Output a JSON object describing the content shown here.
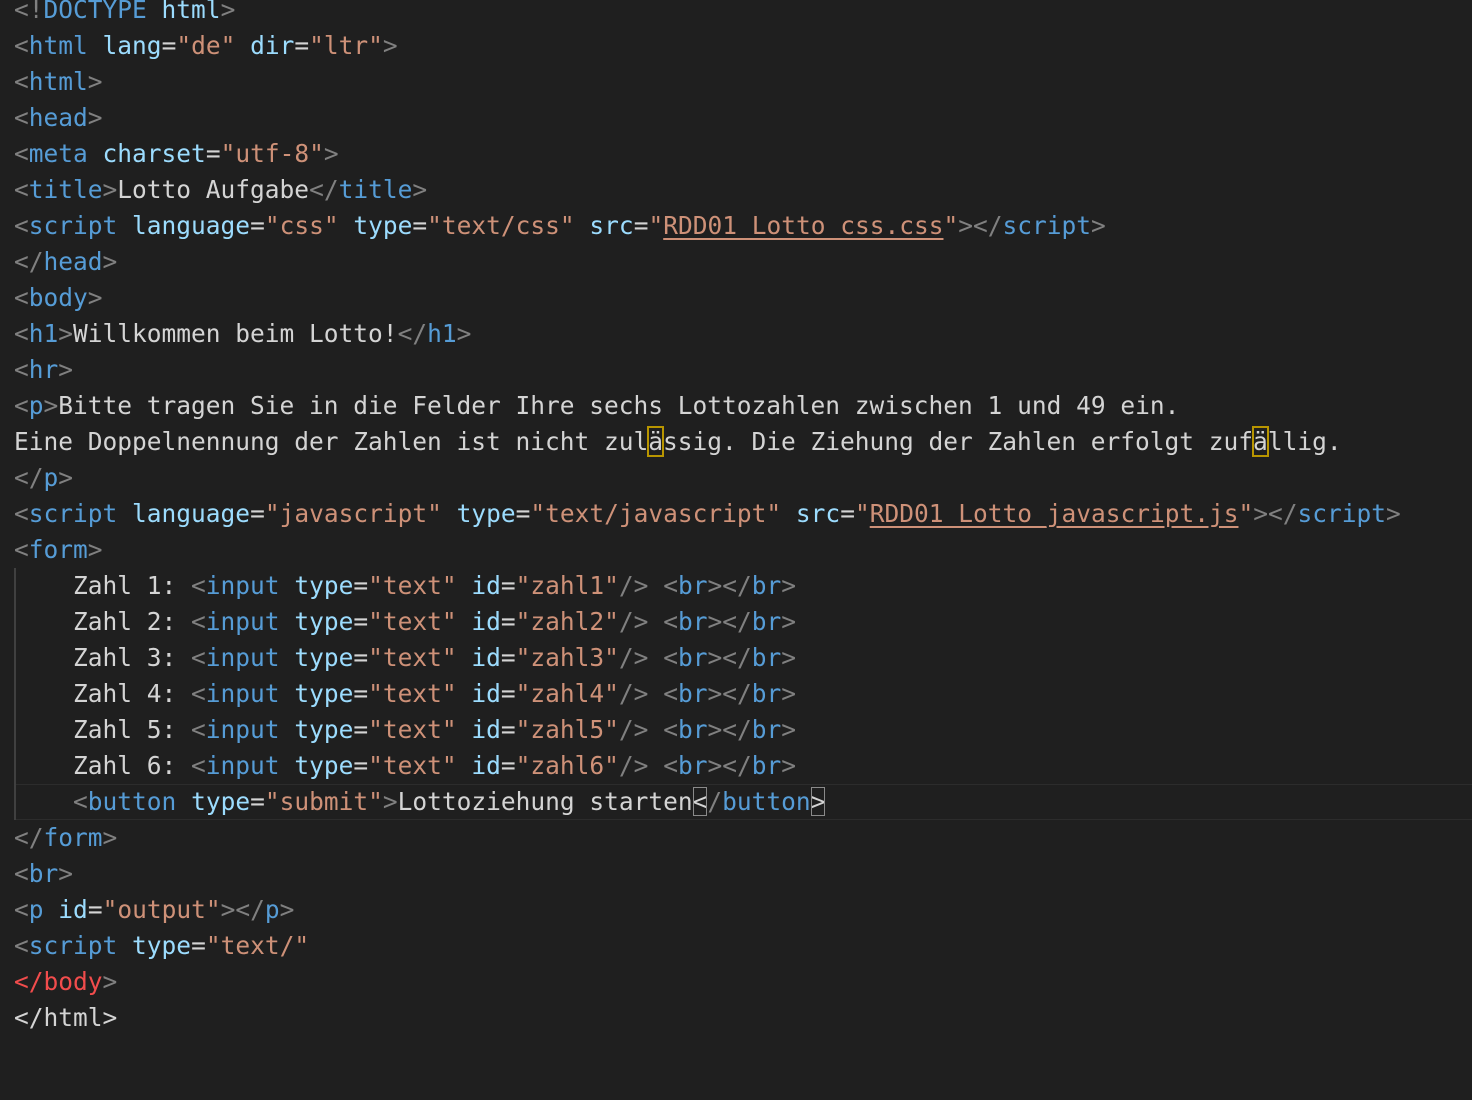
{
  "editor": {
    "language": "html",
    "colors": {
      "background": "#1f1f1f",
      "tag": "#569cd6",
      "attribute": "#9cdcfe",
      "string": "#ce9178",
      "text": "#d4d4d4",
      "punctuation": "#808080",
      "error": "#f14c4c"
    },
    "lines": [
      {
        "tokens": [
          [
            "t",
            "<!"
          ],
          [
            "tag",
            "DOCTYPE"
          ],
          [
            "txt",
            " "
          ],
          [
            "attr",
            "html"
          ],
          [
            "t",
            ">"
          ]
        ]
      },
      {
        "tokens": [
          [
            "t",
            "<"
          ],
          [
            "tag",
            "html"
          ],
          [
            "txt",
            " "
          ],
          [
            "attr",
            "lang"
          ],
          [
            "txt",
            "="
          ],
          [
            "str",
            "\"de\""
          ],
          [
            "txt",
            " "
          ],
          [
            "attr",
            "dir"
          ],
          [
            "txt",
            "="
          ],
          [
            "str",
            "\"ltr\""
          ],
          [
            "t",
            ">"
          ]
        ]
      },
      {
        "tokens": [
          [
            "t",
            "<"
          ],
          [
            "tag",
            "html"
          ],
          [
            "t",
            ">"
          ]
        ]
      },
      {
        "tokens": [
          [
            "t",
            "<"
          ],
          [
            "tag",
            "head"
          ],
          [
            "t",
            ">"
          ]
        ]
      },
      {
        "tokens": [
          [
            "t",
            "<"
          ],
          [
            "tag",
            "meta"
          ],
          [
            "txt",
            " "
          ],
          [
            "attr",
            "charset"
          ],
          [
            "txt",
            "="
          ],
          [
            "str",
            "\"utf-8\""
          ],
          [
            "t",
            ">"
          ]
        ]
      },
      {
        "tokens": [
          [
            "t",
            "<"
          ],
          [
            "tag",
            "title"
          ],
          [
            "t",
            ">"
          ],
          [
            "txt",
            "Lotto Aufgabe"
          ],
          [
            "t",
            "</"
          ],
          [
            "tag",
            "title"
          ],
          [
            "t",
            ">"
          ]
        ]
      },
      {
        "tokens": [
          [
            "t",
            "<"
          ],
          [
            "tag",
            "script"
          ],
          [
            "txt",
            " "
          ],
          [
            "attr",
            "language"
          ],
          [
            "txt",
            "="
          ],
          [
            "str",
            "\"css\""
          ],
          [
            "txt",
            " "
          ],
          [
            "attr",
            "type"
          ],
          [
            "txt",
            "="
          ],
          [
            "str",
            "\"text/css\""
          ],
          [
            "txt",
            " "
          ],
          [
            "attr",
            "src"
          ],
          [
            "txt",
            "="
          ],
          [
            "str",
            "\""
          ],
          [
            "link",
            "RDD01_Lotto_css.css"
          ],
          [
            "str",
            "\""
          ],
          [
            "t",
            "></"
          ],
          [
            "tag",
            "script"
          ],
          [
            "t",
            ">"
          ]
        ]
      },
      {
        "tokens": [
          [
            "t",
            "</"
          ],
          [
            "tag",
            "head"
          ],
          [
            "t",
            ">"
          ]
        ]
      },
      {
        "tokens": [
          [
            "t",
            "<"
          ],
          [
            "tag",
            "body"
          ],
          [
            "t",
            ">"
          ]
        ]
      },
      {
        "tokens": [
          [
            "t",
            "<"
          ],
          [
            "tag",
            "h1"
          ],
          [
            "t",
            ">"
          ],
          [
            "txt",
            "Willkommen beim Lotto!"
          ],
          [
            "t",
            "</"
          ],
          [
            "tag",
            "h1"
          ],
          [
            "t",
            ">"
          ]
        ]
      },
      {
        "tokens": [
          [
            "t",
            "<"
          ],
          [
            "tag",
            "hr"
          ],
          [
            "t",
            ">"
          ]
        ]
      },
      {
        "tokens": [
          [
            "t",
            "<"
          ],
          [
            "tag",
            "p"
          ],
          [
            "t",
            ">"
          ],
          [
            "txt",
            "Bitte tragen Sie in die Felder Ihre sechs Lottozahlen zwischen 1 und 49 ein."
          ]
        ]
      },
      {
        "tokens": [
          [
            "txt",
            "Eine Doppelnennung der Zahlen ist nicht zul"
          ],
          [
            "hl",
            "ä"
          ],
          [
            "txt",
            "ssig. Die Ziehung der Zahlen erfolgt zuf"
          ],
          [
            "hl",
            "ä"
          ],
          [
            "txt",
            "llig."
          ]
        ]
      },
      {
        "tokens": [
          [
            "t",
            "</"
          ],
          [
            "tag",
            "p"
          ],
          [
            "t",
            ">"
          ]
        ]
      },
      {
        "tokens": [
          [
            "t",
            "<"
          ],
          [
            "tag",
            "script"
          ],
          [
            "txt",
            " "
          ],
          [
            "attr",
            "language"
          ],
          [
            "txt",
            "="
          ],
          [
            "str",
            "\"javascript\""
          ],
          [
            "txt",
            " "
          ],
          [
            "attr",
            "type"
          ],
          [
            "txt",
            "="
          ],
          [
            "str",
            "\"text/javascript\""
          ],
          [
            "txt",
            " "
          ],
          [
            "attr",
            "src"
          ],
          [
            "txt",
            "="
          ],
          [
            "str",
            "\""
          ],
          [
            "link",
            "RDD01_Lotto_javascript.js"
          ],
          [
            "str",
            "\""
          ],
          [
            "t",
            "></"
          ],
          [
            "tag",
            "script"
          ],
          [
            "t",
            ">"
          ]
        ]
      },
      {
        "tokens": [
          [
            "t",
            "<"
          ],
          [
            "tag",
            "form"
          ],
          [
            "t",
            ">"
          ]
        ]
      },
      {
        "tokens": [
          [
            "txt",
            "    Zahl 1: "
          ],
          [
            "t",
            "<"
          ],
          [
            "tag",
            "input"
          ],
          [
            "txt",
            " "
          ],
          [
            "attr",
            "type"
          ],
          [
            "txt",
            "="
          ],
          [
            "str",
            "\"text\""
          ],
          [
            "txt",
            " "
          ],
          [
            "attr",
            "id"
          ],
          [
            "txt",
            "="
          ],
          [
            "str",
            "\"zahl1\""
          ],
          [
            "t",
            "/>"
          ],
          [
            "txt",
            " "
          ],
          [
            "t",
            "<"
          ],
          [
            "tag",
            "br"
          ],
          [
            "t",
            "></"
          ],
          [
            "tag",
            "br"
          ],
          [
            "t",
            ">"
          ]
        ]
      },
      {
        "tokens": [
          [
            "txt",
            "    Zahl 2: "
          ],
          [
            "t",
            "<"
          ],
          [
            "tag",
            "input"
          ],
          [
            "txt",
            " "
          ],
          [
            "attr",
            "type"
          ],
          [
            "txt",
            "="
          ],
          [
            "str",
            "\"text\""
          ],
          [
            "txt",
            " "
          ],
          [
            "attr",
            "id"
          ],
          [
            "txt",
            "="
          ],
          [
            "str",
            "\"zahl2\""
          ],
          [
            "t",
            "/>"
          ],
          [
            "txt",
            " "
          ],
          [
            "t",
            "<"
          ],
          [
            "tag",
            "br"
          ],
          [
            "t",
            "></"
          ],
          [
            "tag",
            "br"
          ],
          [
            "t",
            ">"
          ]
        ]
      },
      {
        "tokens": [
          [
            "txt",
            "    Zahl 3: "
          ],
          [
            "t",
            "<"
          ],
          [
            "tag",
            "input"
          ],
          [
            "txt",
            " "
          ],
          [
            "attr",
            "type"
          ],
          [
            "txt",
            "="
          ],
          [
            "str",
            "\"text\""
          ],
          [
            "txt",
            " "
          ],
          [
            "attr",
            "id"
          ],
          [
            "txt",
            "="
          ],
          [
            "str",
            "\"zahl3\""
          ],
          [
            "t",
            "/>"
          ],
          [
            "txt",
            " "
          ],
          [
            "t",
            "<"
          ],
          [
            "tag",
            "br"
          ],
          [
            "t",
            "></"
          ],
          [
            "tag",
            "br"
          ],
          [
            "t",
            ">"
          ]
        ]
      },
      {
        "tokens": [
          [
            "txt",
            "    Zahl 4: "
          ],
          [
            "t",
            "<"
          ],
          [
            "tag",
            "input"
          ],
          [
            "txt",
            " "
          ],
          [
            "attr",
            "type"
          ],
          [
            "txt",
            "="
          ],
          [
            "str",
            "\"text\""
          ],
          [
            "txt",
            " "
          ],
          [
            "attr",
            "id"
          ],
          [
            "txt",
            "="
          ],
          [
            "str",
            "\"zahl4\""
          ],
          [
            "t",
            "/>"
          ],
          [
            "txt",
            " "
          ],
          [
            "t",
            "<"
          ],
          [
            "tag",
            "br"
          ],
          [
            "t",
            "></"
          ],
          [
            "tag",
            "br"
          ],
          [
            "t",
            ">"
          ]
        ]
      },
      {
        "tokens": [
          [
            "txt",
            "    Zahl 5: "
          ],
          [
            "t",
            "<"
          ],
          [
            "tag",
            "input"
          ],
          [
            "txt",
            " "
          ],
          [
            "attr",
            "type"
          ],
          [
            "txt",
            "="
          ],
          [
            "str",
            "\"text\""
          ],
          [
            "txt",
            " "
          ],
          [
            "attr",
            "id"
          ],
          [
            "txt",
            "="
          ],
          [
            "str",
            "\"zahl5\""
          ],
          [
            "t",
            "/>"
          ],
          [
            "txt",
            " "
          ],
          [
            "t",
            "<"
          ],
          [
            "tag",
            "br"
          ],
          [
            "t",
            "></"
          ],
          [
            "tag",
            "br"
          ],
          [
            "t",
            ">"
          ]
        ]
      },
      {
        "tokens": [
          [
            "txt",
            "    Zahl 6: "
          ],
          [
            "t",
            "<"
          ],
          [
            "tag",
            "input"
          ],
          [
            "txt",
            " "
          ],
          [
            "attr",
            "type"
          ],
          [
            "txt",
            "="
          ],
          [
            "str",
            "\"text\""
          ],
          [
            "txt",
            " "
          ],
          [
            "attr",
            "id"
          ],
          [
            "txt",
            "="
          ],
          [
            "str",
            "\"zahl6\""
          ],
          [
            "t",
            "/>"
          ],
          [
            "txt",
            " "
          ],
          [
            "t",
            "<"
          ],
          [
            "tag",
            "br"
          ],
          [
            "t",
            "></"
          ],
          [
            "tag",
            "br"
          ],
          [
            "t",
            ">"
          ]
        ]
      },
      {
        "tokens": [
          [
            "txt",
            "    "
          ],
          [
            "t",
            "<"
          ],
          [
            "tag",
            "button"
          ],
          [
            "txt",
            " "
          ],
          [
            "attr",
            "type"
          ],
          [
            "txt",
            "="
          ],
          [
            "str",
            "\"submit\""
          ],
          [
            "t",
            ">"
          ],
          [
            "txt",
            "Lottoziehung starten"
          ],
          [
            "box",
            "<"
          ],
          [
            "t",
            "/"
          ],
          [
            "tag",
            "button"
          ],
          [
            "box",
            ">"
          ]
        ]
      },
      {
        "tokens": [
          [
            "t",
            "</"
          ],
          [
            "tag",
            "form"
          ],
          [
            "t",
            ">"
          ]
        ]
      },
      {
        "tokens": [
          [
            "t",
            "<"
          ],
          [
            "tag",
            "br"
          ],
          [
            "t",
            ">"
          ]
        ]
      },
      {
        "tokens": [
          [
            "t",
            "<"
          ],
          [
            "tag",
            "p"
          ],
          [
            "txt",
            " "
          ],
          [
            "attr",
            "id"
          ],
          [
            "txt",
            "="
          ],
          [
            "str",
            "\"output\""
          ],
          [
            "t",
            "></"
          ],
          [
            "tag",
            "p"
          ],
          [
            "t",
            ">"
          ]
        ]
      },
      {
        "tokens": [
          [
            "t",
            "<"
          ],
          [
            "tag",
            "script"
          ],
          [
            "txt",
            " "
          ],
          [
            "attr",
            "type"
          ],
          [
            "txt",
            "="
          ],
          [
            "str",
            "\"text/\""
          ]
        ]
      },
      {
        "tokens": [
          [
            "err",
            "</body"
          ],
          [
            "t",
            ">"
          ]
        ]
      },
      {
        "tokens": [
          [
            "txt",
            "</html>"
          ]
        ]
      }
    ]
  }
}
